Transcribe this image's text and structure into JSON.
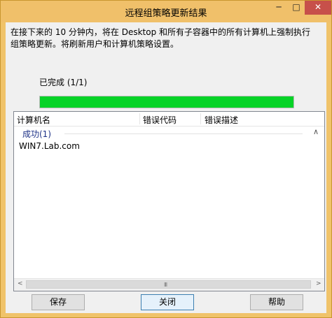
{
  "window": {
    "title": "远程组策略更新结果",
    "minimize": "─",
    "maximize": "□",
    "close": "✕"
  },
  "description": "在接下来的 10 分钟内，将在 Desktop 和所有子容器中的所有计算机上强制执行组策略更新。将刷新用户和计算机策略设置。",
  "status": "已完成 (1/1)",
  "progress": {
    "value": 1.0,
    "color": "#06d327"
  },
  "list": {
    "columns": [
      "计算机名",
      "错误代码",
      "错误描述"
    ],
    "group": {
      "label": "成功(1)",
      "chevron": "∧"
    },
    "rows": [
      {
        "computer": "WIN7.Lab.com",
        "error_code": "",
        "error_desc": ""
      }
    ],
    "scroll": {
      "left": "<",
      "right": ">",
      "grip": "III"
    }
  },
  "buttons": {
    "save": "保存",
    "close": "关闭",
    "help": "帮助"
  },
  "colors": {
    "accent": "#f0c06a",
    "close_button": "#c7504a"
  }
}
